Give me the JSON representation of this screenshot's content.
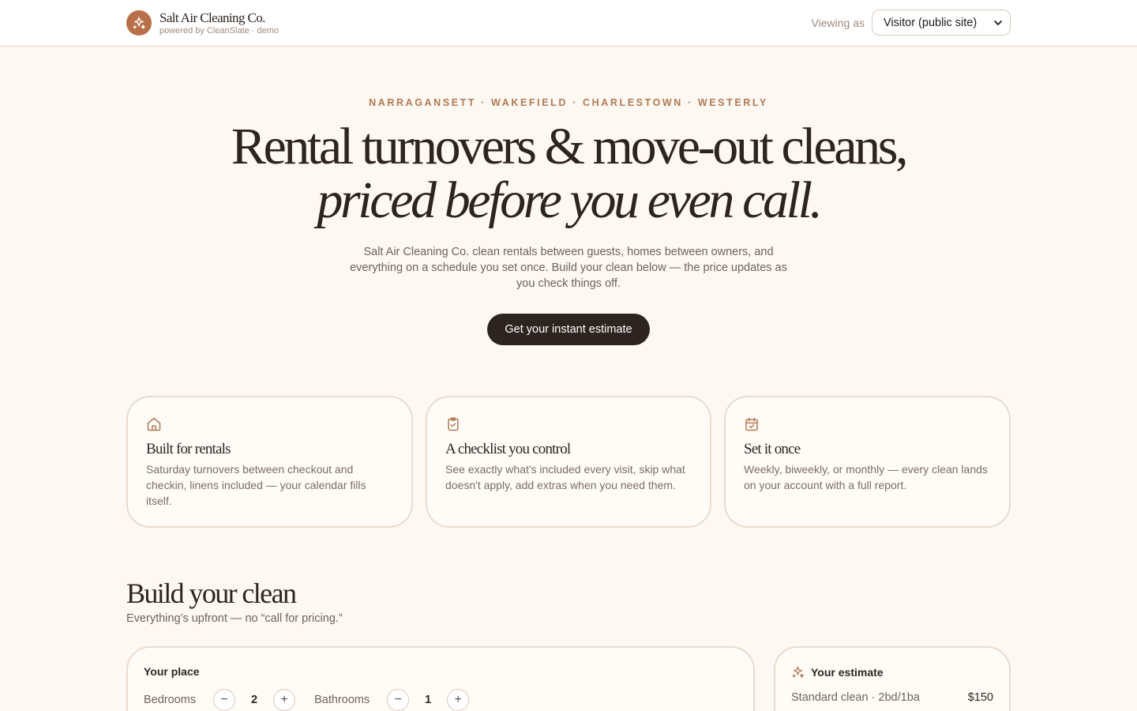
{
  "header": {
    "brand_name": "Salt Air Cleaning Co.",
    "brand_sub": "powered by CleanSlate · demo",
    "logo_icon": "sparkle-icon",
    "viewing_label": "Viewing as",
    "viewing_value": "Visitor (public site)"
  },
  "hero": {
    "kicker": "NARRAGANSETT · WAKEFIELD · CHARLESTOWN · WESTERLY",
    "headline_line1": "Rental turnovers & move-out cleans,",
    "headline_line2": "priced before you even call.",
    "lede": "Salt Air Cleaning Co. clean rentals between guests, homes between owners, and everything on a schedule you set once. Build your clean below — the price updates as you check things off.",
    "cta_label": "Get your instant estimate"
  },
  "features": [
    {
      "icon": "house-icon",
      "title": "Built for rentals",
      "body": "Saturday turnovers between checkout and checkin, linens included — your calendar fills itself."
    },
    {
      "icon": "clipboard-check-icon",
      "title": "A checklist you control",
      "body": "See exactly what's included every visit, skip what doesn't apply, add extras when you need them."
    },
    {
      "icon": "calendar-check-icon",
      "title": "Set it once",
      "body": "Weekly, biweekly, or monthly — every clean lands on your account with a full report."
    }
  ],
  "build": {
    "title": "Build your clean",
    "subtitle": "Everything’s upfront — no “call for pricing.”",
    "place_title": "Your place",
    "bedrooms_label": "Bedrooms",
    "bedrooms_value": "2",
    "bathrooms_label": "Bathrooms",
    "bathrooms_value": "1",
    "minus_symbol": "−",
    "plus_symbol": "+"
  },
  "estimate": {
    "title": "Your estimate",
    "line_label": "Standard clean · 2bd/1ba",
    "line_price": "$150"
  },
  "colors": {
    "accent": "#b8704a",
    "background": "#fdf8f2",
    "dark": "#2d2420"
  }
}
